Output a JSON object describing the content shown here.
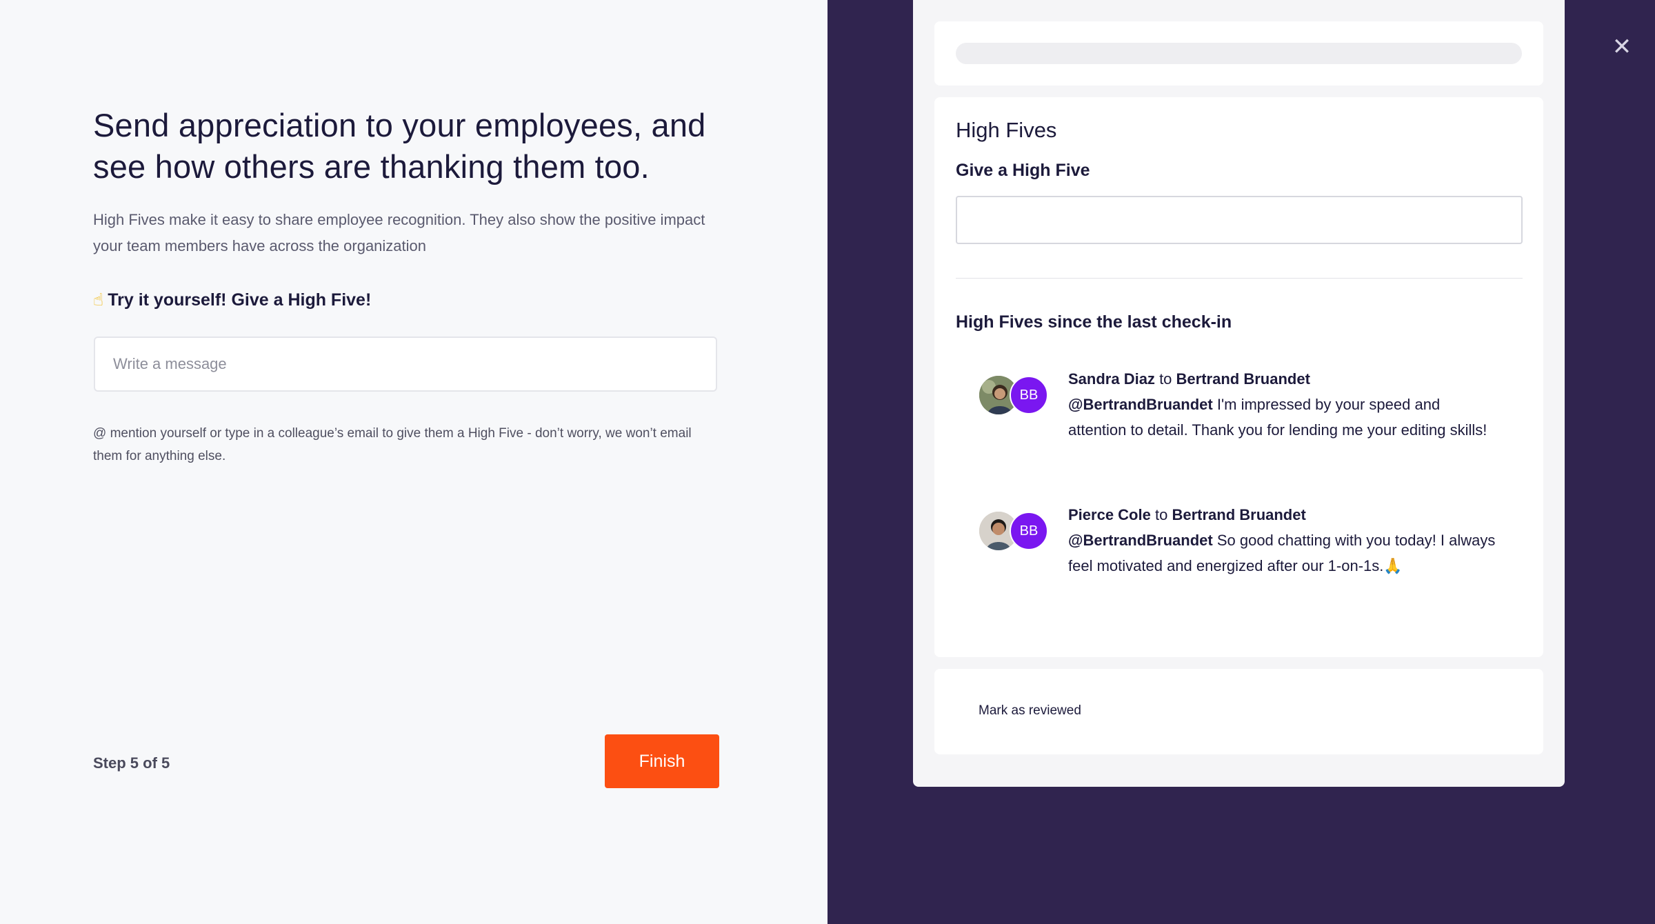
{
  "intro": {
    "headline": "Send appreciation to your employees, and see how others are thanking them too.",
    "description": "High Fives make it easy to share employee recognition. They also show the positive impact your team members have across the organization",
    "try_emoji": "☝",
    "try_label": "Try it yourself! Give a High Five!",
    "message_placeholder": "Write a message",
    "hint": "@ mention yourself or type in a colleague’s email to give them a High Five - don’t worry, we won’t email them for anything else.",
    "step": "Step 5 of 5",
    "finish_label": "Finish"
  },
  "preview": {
    "title": "High Fives",
    "give_label": "Give a High Five",
    "since_title": "High Fives since the last check-in",
    "items": [
      {
        "from": "Sandra Diaz",
        "to_word": "to",
        "to": "Bertrand Bruandet",
        "mention": "@BertrandBruandet",
        "message": "I'm impressed by your speed and attention to detail. Thank you for lending me your editing skills!",
        "recipient_initials": "BB"
      },
      {
        "from": "Pierce Cole",
        "to_word": "to",
        "to": "Bertrand Bruandet",
        "mention": "@BertrandBruandet",
        "message": "So good chatting with you today! I always feel motivated and energized after our 1-on-1s.🙏",
        "recipient_initials": "BB"
      }
    ],
    "mark_reviewed": "Mark as reviewed"
  },
  "close_icon": "close-icon",
  "colors": {
    "accent": "#fc4f12",
    "panel_bg": "#30244f",
    "avatar_purple": "#7a17f0"
  }
}
